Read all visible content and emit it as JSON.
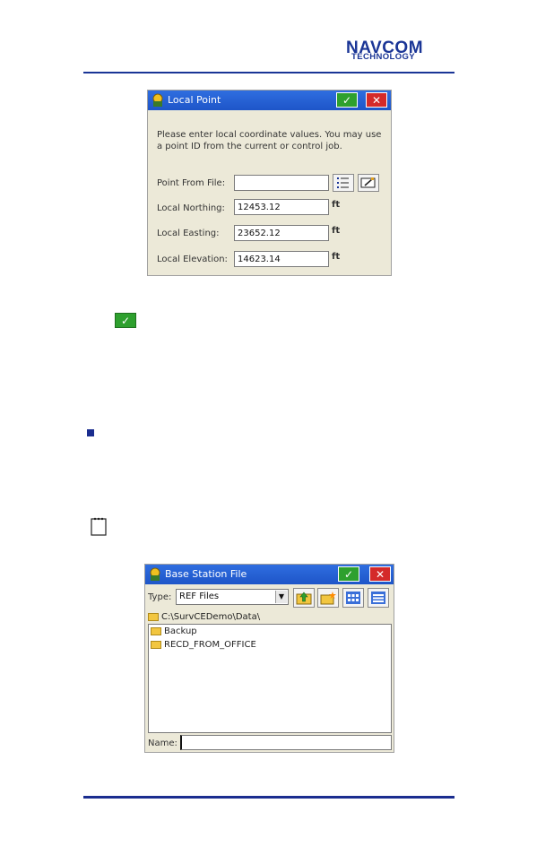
{
  "header": {
    "logo_line1": "NAVCOM",
    "logo_line2": "TECHNOLOGY",
    "brand_color": "#1a3596"
  },
  "local_point_dialog": {
    "title": "Local Point",
    "ok_icon": "check-icon",
    "close_icon": "close-icon",
    "instructions": "Please enter local coordinate values.  You may use a point ID from the current or control job.",
    "fields": [
      {
        "label": "Point From File:",
        "value": "",
        "unit": ""
      },
      {
        "label": "Local Northing:",
        "value": "12453.12",
        "unit": "ft"
      },
      {
        "label": "Local Easting:",
        "value": "23652.12",
        "unit": "ft"
      },
      {
        "label": "Local Elevation:",
        "value": "14623.14",
        "unit": "ft"
      }
    ],
    "list_button_icon": "list-icon",
    "edit_button_icon": "edit-icon"
  },
  "body_icons": {
    "ok_icon": "check-icon",
    "bullet_icon": "square-bullet-icon",
    "note_icon": "notepad-icon"
  },
  "base_station_dialog": {
    "title": "Base Station File",
    "type_label": "Type:",
    "type_value": "REF Files",
    "path": "C:\\SurvCEDemo\\Data\\",
    "items": [
      {
        "name": "Backup"
      },
      {
        "name": "RECD_FROM_OFFICE"
      }
    ],
    "name_label": "Name:",
    "name_value": "",
    "toolbar_icons": [
      "folder-up-icon",
      "new-folder-icon",
      "large-icons-view-icon",
      "details-view-icon"
    ]
  }
}
